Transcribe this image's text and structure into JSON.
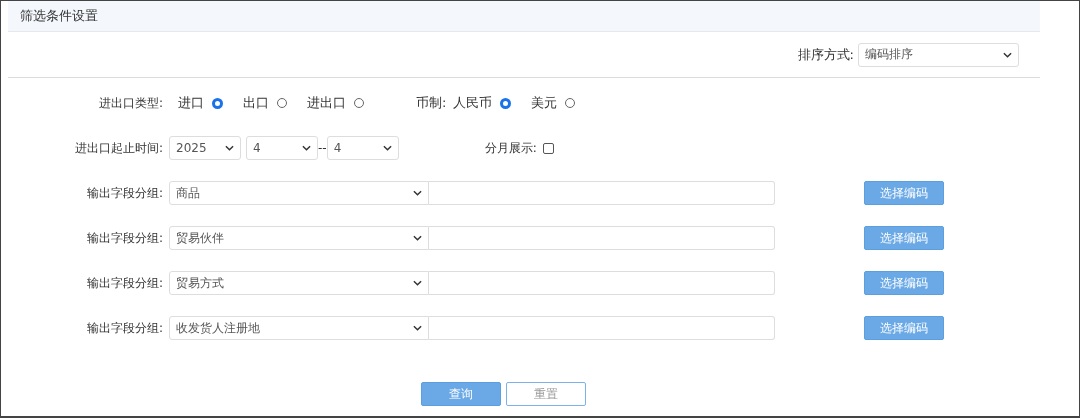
{
  "title": "筛选条件设置",
  "sort": {
    "label": "排序方式:",
    "value": "编码排序"
  },
  "trade_type": {
    "label": "进出口类型:",
    "options": [
      {
        "label": "进口",
        "selected": true
      },
      {
        "label": "出口",
        "selected": false
      },
      {
        "label": "进出口",
        "selected": false
      }
    ]
  },
  "currency": {
    "label": "币制:",
    "options": [
      {
        "label": "人民币",
        "selected": true
      },
      {
        "label": "美元",
        "selected": false
      }
    ]
  },
  "period": {
    "label": "进出口起止时间:",
    "year": "2025",
    "start_month": "4",
    "separator": "--",
    "end_month": "4"
  },
  "monthly": {
    "label": "分月展示:",
    "checked": false
  },
  "groups": [
    {
      "label": "输出字段分组:",
      "value": "商品",
      "button": "选择编码"
    },
    {
      "label": "输出字段分组:",
      "value": "贸易伙伴",
      "button": "选择编码"
    },
    {
      "label": "输出字段分组:",
      "value": "贸易方式",
      "button": "选择编码"
    },
    {
      "label": "输出字段分组:",
      "value": "收发货人注册地",
      "button": "选择编码"
    }
  ],
  "buttons": [
    {
      "label": "查询",
      "kind": "primary"
    },
    {
      "label": "重置",
      "kind": "secondary"
    }
  ]
}
